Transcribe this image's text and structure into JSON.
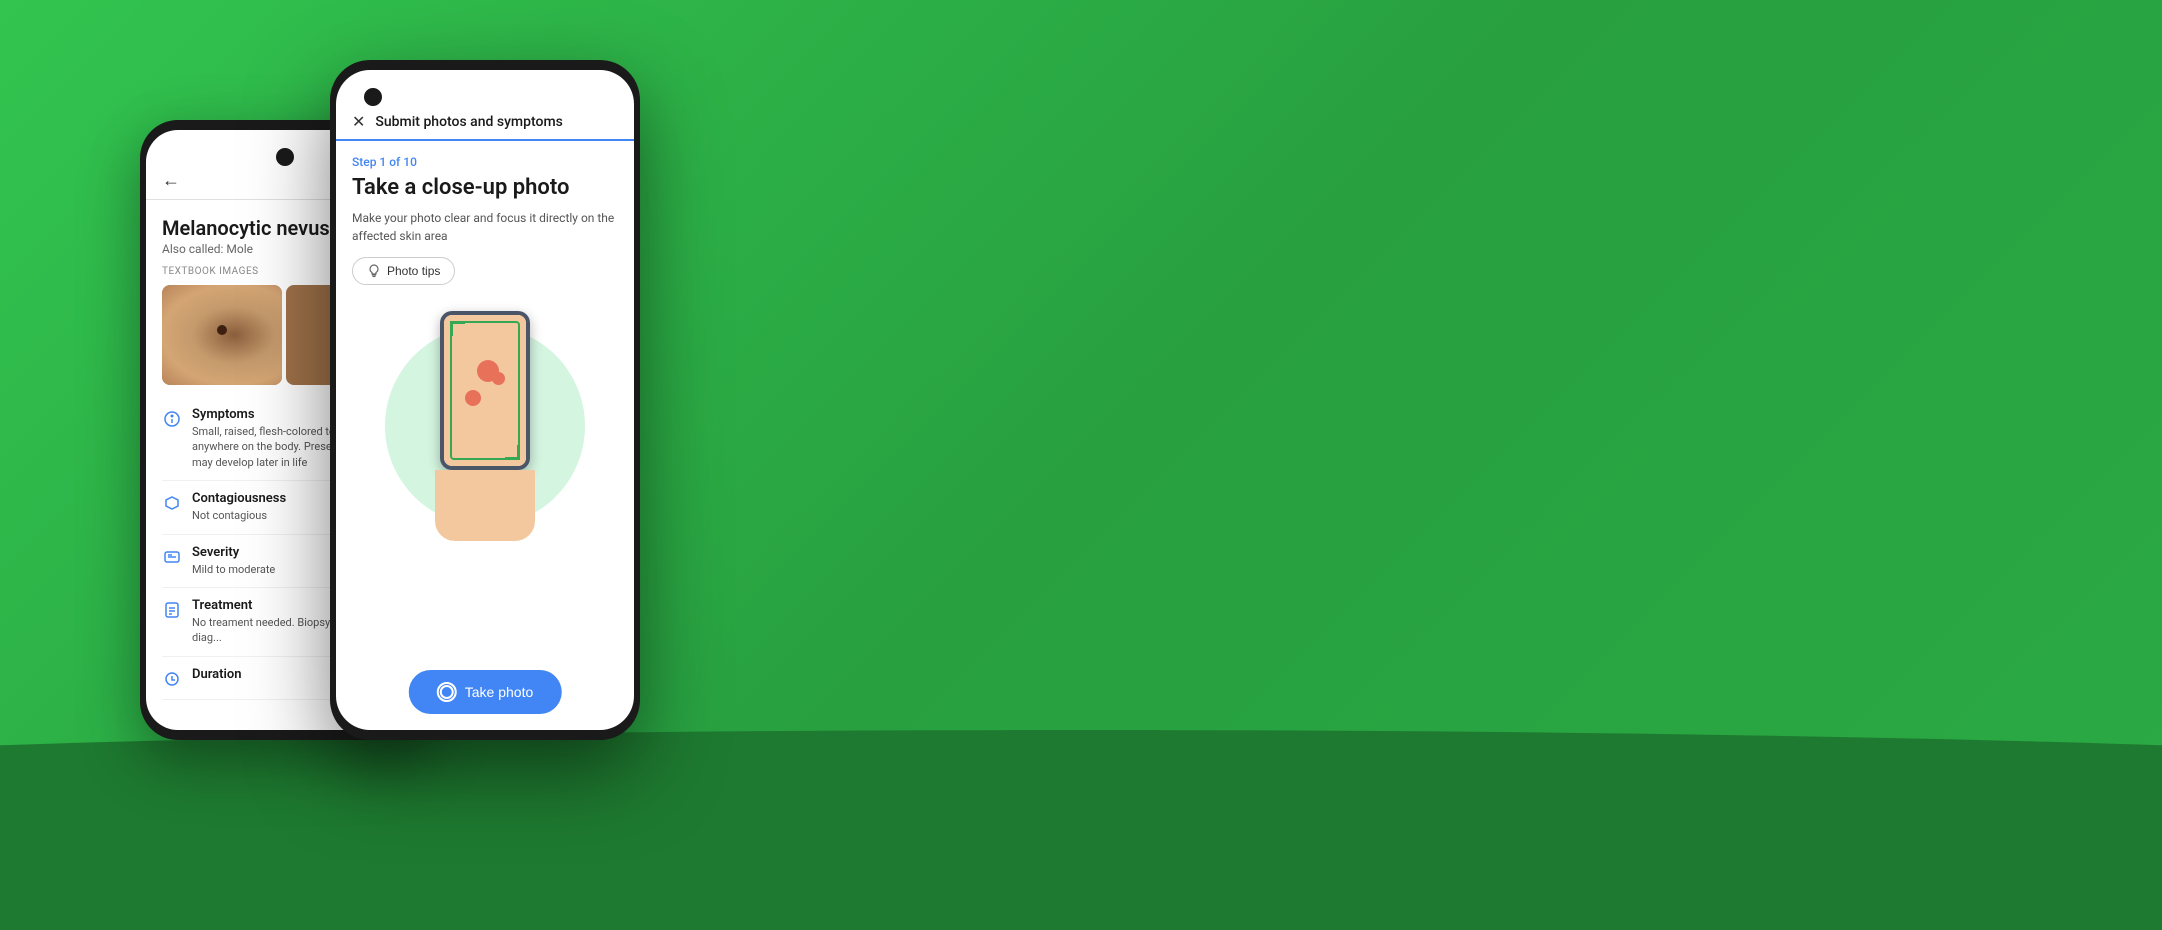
{
  "background": {
    "color": "#2eb84b"
  },
  "phone1": {
    "back_button": "←",
    "title": "Melanocytic nevus",
    "subtitle": "Also called: Mole",
    "images_label": "TEXTBOOK IMAGES",
    "symptoms": {
      "label": "Symptoms",
      "description": "Small, raised, flesh-colored to brown growth anywhere on the body. Present at birth or may develop later in life"
    },
    "contagiousness": {
      "label": "Contagiousness",
      "description": "Not contagious"
    },
    "severity": {
      "label": "Severity",
      "description": "Mild to moderate"
    },
    "treatment": {
      "label": "Treatment",
      "description": "No treament needed. Biopsy to make a diag..."
    },
    "duration": {
      "label": "Duration"
    }
  },
  "phone2": {
    "topbar_title": "Submit photos and symptoms",
    "step_label": "Step 1 of 10",
    "main_title": "Take a close-up photo",
    "description": "Make your photo clear and focus it directly on the affected skin area",
    "photo_tips_label": "Photo tips",
    "take_photo_label": "Take photo"
  }
}
